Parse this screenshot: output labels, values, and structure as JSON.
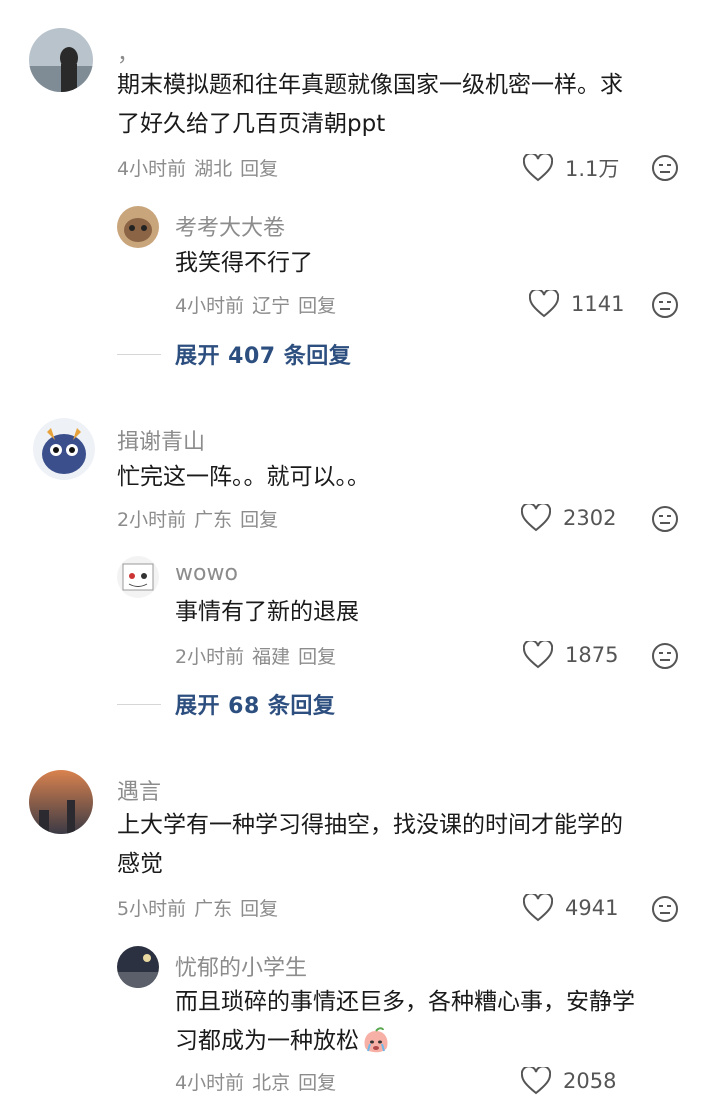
{
  "comments": [
    {
      "username": "，",
      "content_lines": [
        "期末模拟题和往年真题就像国家一级机密一样。求",
        "了好久给了几百页清朝ppt"
      ],
      "time": "4小时前",
      "location": "湖北",
      "reply_label": "回复",
      "likes": "1.1万",
      "replies": [
        {
          "username": "考考大大卷",
          "content_lines": [
            "我笑得不行了"
          ],
          "time": "4小时前",
          "location": "辽宁",
          "reply_label": "回复",
          "likes": "1141"
        }
      ],
      "expand_text": "展开 407 条回复"
    },
    {
      "username": "揖谢青山",
      "content_lines": [
        "忙完这一阵。。就可以。。"
      ],
      "time": "2小时前",
      "location": "广东",
      "reply_label": "回复",
      "likes": "2302",
      "replies": [
        {
          "username": "wowo",
          "content_lines": [
            "事情有了新的退展"
          ],
          "time": "2小时前",
          "location": "福建",
          "reply_label": "回复",
          "likes": "1875"
        }
      ],
      "expand_text": "展开 68 条回复"
    },
    {
      "username": "遇言",
      "content_lines": [
        "上大学有一种学习得抽空，找没课的时间才能学的",
        "感觉"
      ],
      "time": "5小时前",
      "location": "广东",
      "reply_label": "回复",
      "likes": "4941",
      "replies": [
        {
          "username": "忧郁的小学生",
          "content_lines": [
            "而且琐碎的事情还巨多，各种糟心事，安静学",
            "习都成为一种放松"
          ],
          "time": "4小时前",
          "location": "北京",
          "reply_label": "回复",
          "likes": "2058"
        }
      ]
    }
  ],
  "icons": {
    "like": "heart-outline-icon",
    "dislike": "neutral-face-icon",
    "emoji": "crying-peach-emoji"
  },
  "colors": {
    "text": "#1a1a1a",
    "meta": "#8c8c8c",
    "expand_link": "#2d4f80"
  }
}
